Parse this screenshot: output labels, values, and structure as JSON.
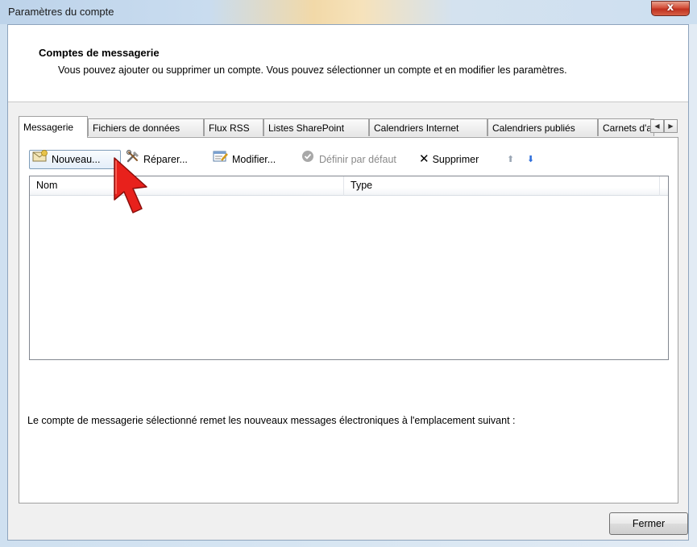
{
  "window": {
    "title": "Paramètres du compte",
    "close_glyph": "x"
  },
  "header": {
    "title": "Comptes de messagerie",
    "description": "Vous pouvez ajouter ou supprimer un compte. Vous pouvez sélectionner un compte et en modifier les paramètres."
  },
  "tabs": [
    {
      "label": "Messagerie",
      "active": true
    },
    {
      "label": "Fichiers de données",
      "active": false
    },
    {
      "label": "Flux RSS",
      "active": false
    },
    {
      "label": "Listes SharePoint",
      "active": false
    },
    {
      "label": "Calendriers Internet",
      "active": false
    },
    {
      "label": "Calendriers publiés",
      "active": false
    },
    {
      "label": "Carnets d'adresses",
      "active": false
    }
  ],
  "tab_scroll": {
    "left": "◀",
    "right": "▶"
  },
  "toolbar": {
    "new_label": "Nouveau...",
    "repair_label": "Réparer...",
    "modify_label": "Modifier...",
    "default_label": "Définir par défaut",
    "delete_label": "Supprimer",
    "delete_glyph": "✕",
    "up_glyph": "⬆",
    "down_glyph": "⬇"
  },
  "list": {
    "columns": [
      "Nom",
      "Type"
    ],
    "rows": []
  },
  "location_text": "Le compte de messagerie sélectionné remet les nouveaux messages électroniques à l'emplacement suivant :",
  "footer": {
    "close_label": "Fermer"
  },
  "colors": {
    "cursor_red": "#e8211c",
    "up_arrow_disabled": "#9aa6b4",
    "down_arrow": "#2f6fdc"
  }
}
